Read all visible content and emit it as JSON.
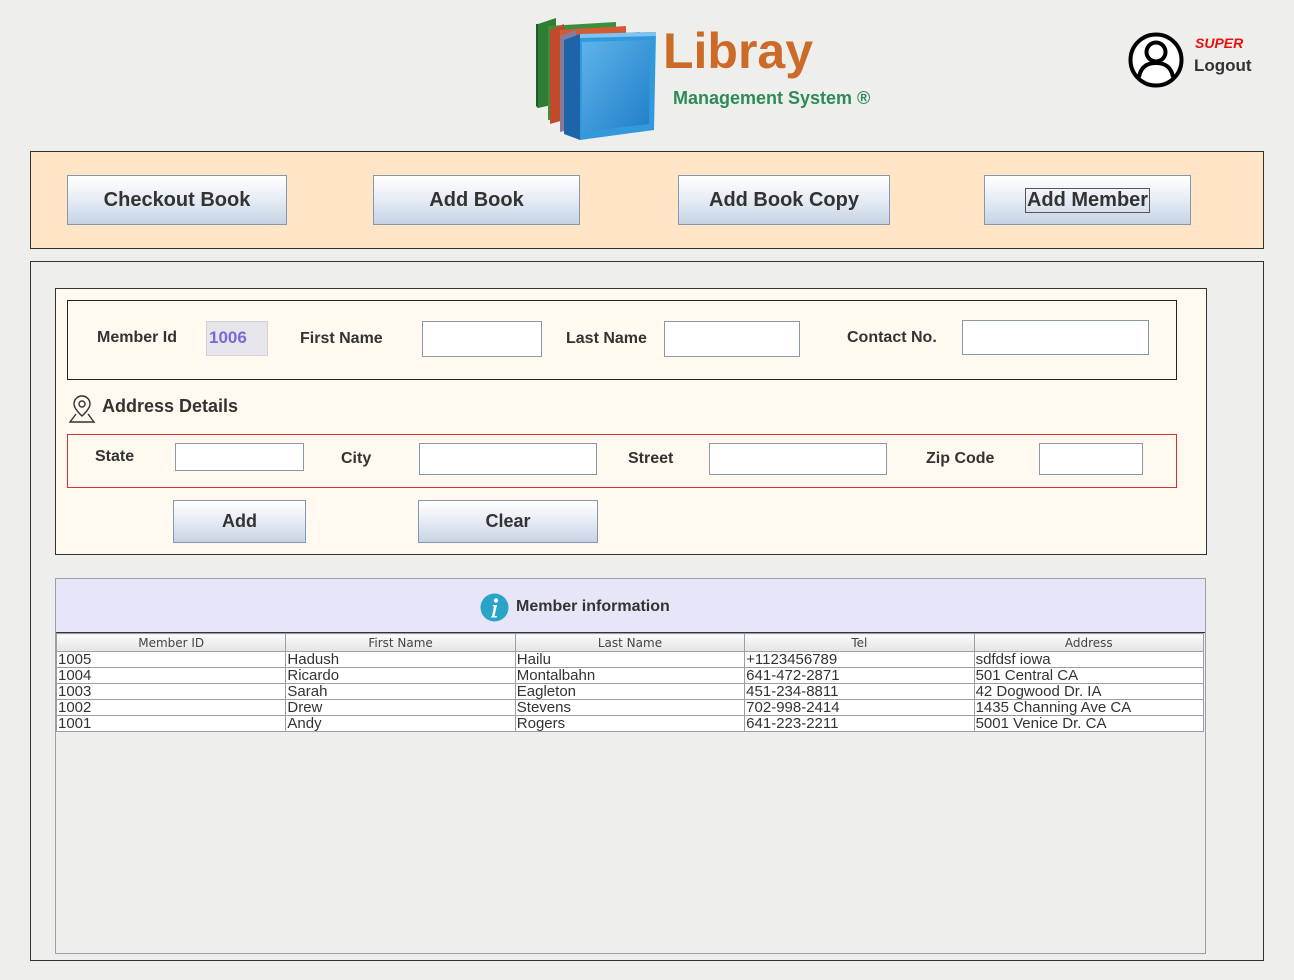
{
  "header": {
    "app_title": "Libray",
    "app_subtitle": "Management System ®",
    "user_role": "SUPER",
    "logout_label": "Logout"
  },
  "menu": {
    "checkout_book": "Checkout Book",
    "add_book": "Add Book",
    "add_book_copy": "Add Book Copy",
    "add_member": "Add Member"
  },
  "form": {
    "member_id_label": "Member Id",
    "member_id_value": "1006",
    "first_name_label": "First Name",
    "first_name_value": "",
    "last_name_label": "Last Name",
    "last_name_value": "",
    "contact_label": "Contact No.",
    "contact_value": "",
    "address_title": "Address Details",
    "state_label": "State",
    "state_value": "",
    "city_label": "City",
    "city_value": "",
    "street_label": "Street",
    "street_value": "",
    "zip_label": "Zip Code",
    "zip_value": "",
    "add_button": "Add",
    "clear_button": "Clear"
  },
  "member_info": {
    "title": "Member information",
    "columns": [
      "Member ID",
      "First Name",
      "Last Name",
      "Tel",
      "Address"
    ],
    "rows": [
      [
        "1005",
        "Hadush",
        "Hailu",
        "+1123456789",
        "sdfdsf iowa"
      ],
      [
        "1004",
        "Ricardo",
        "Montalbahn",
        "641-472-2871",
        "501 Central CA"
      ],
      [
        "1003",
        "Sarah",
        "Eagleton",
        "451-234-8811",
        "42 Dogwood Dr. IA"
      ],
      [
        "1002",
        "Drew",
        "Stevens",
        "702-998-2414",
        "1435 Channing Ave CA"
      ],
      [
        "1001",
        "Andy",
        "Rogers",
        "641-223-2211",
        "5001 Venice Dr. CA"
      ]
    ]
  },
  "icons": {
    "logo": "books-stack-logo",
    "user": "user-avatar-icon",
    "address": "map-pin-icon",
    "info": "info-icon"
  }
}
